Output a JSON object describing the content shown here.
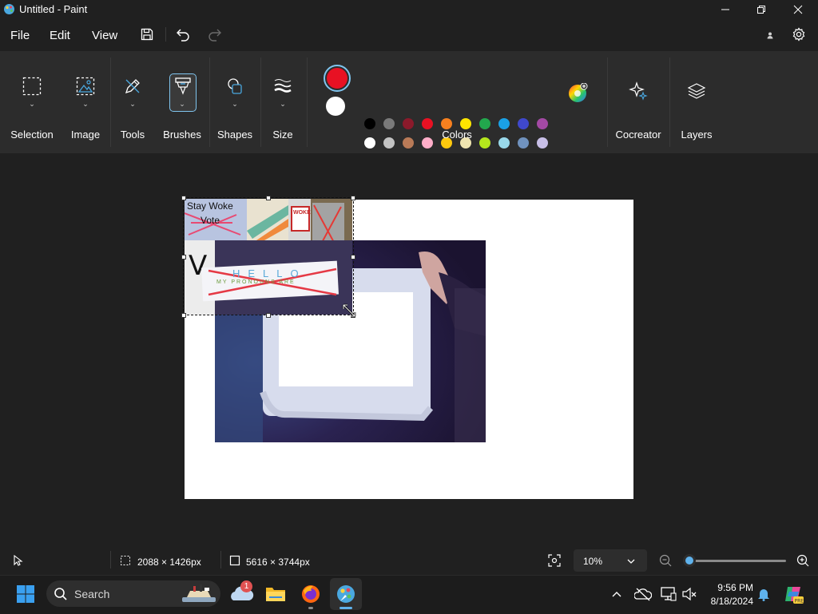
{
  "window": {
    "title": "Untitled - Paint"
  },
  "menu": {
    "file": "File",
    "edit": "Edit",
    "view": "View"
  },
  "ribbon": {
    "selection": "Selection",
    "image": "Image",
    "tools": "Tools",
    "brushes": "Brushes",
    "shapes": "Shapes",
    "size": "Size",
    "colors": "Colors",
    "cocreator": "Cocreator",
    "layers": "Layers"
  },
  "colors": {
    "primary": "#e81123",
    "secondary": "#ffffff",
    "palette_row1": [
      "#000000",
      "#7a7a7a",
      "#8b1a2b",
      "#e81123",
      "#f7801f",
      "#ffe600",
      "#22a84d",
      "#1aa1e6",
      "#3f48cc",
      "#a349a4"
    ],
    "palette_row2": [
      "#ffffff",
      "#c3c3c3",
      "#b97a57",
      "#ffaec9",
      "#ffc90e",
      "#efe4b0",
      "#b5e61d",
      "#99d9ea",
      "#7092be",
      "#c8bfe7"
    ]
  },
  "canvas_content": {
    "sticky_text": "Stay Woke",
    "vote_text": "Vote",
    "sign_text": "WOKE",
    "handwriting": "HELLO",
    "handwriting_sub": "MY PRONOUNS ARE"
  },
  "status": {
    "selection_size": "2088 × 1426px",
    "canvas_size": "5616 × 3744px",
    "zoom": "10%",
    "zoom_slider_value": 0.0
  },
  "taskbar": {
    "search_placeholder": "Search",
    "time": "9:56 PM",
    "date": "8/18/2024",
    "weather_badge": "1"
  }
}
